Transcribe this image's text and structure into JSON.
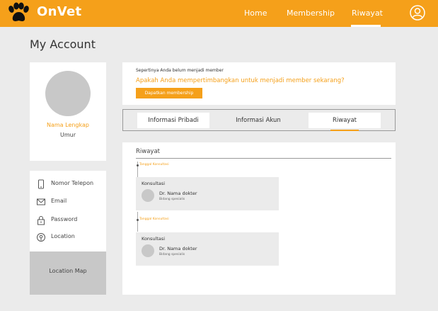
{
  "app": {
    "name": "OnVet"
  },
  "nav": {
    "items": [
      {
        "label": "Home"
      },
      {
        "label": "Membership"
      },
      {
        "label": "Riwayat"
      }
    ],
    "active": "Riwayat"
  },
  "page": {
    "title": "My Account"
  },
  "profile": {
    "name": "Nama Lengkap",
    "age": "Umur"
  },
  "contact": {
    "items": [
      {
        "label": "Nomor Telepon",
        "icon": "phone-icon"
      },
      {
        "label": "Email",
        "icon": "mail-icon"
      },
      {
        "label": "Password",
        "icon": "lock-icon"
      },
      {
        "label": "Location",
        "icon": "location-pin-icon"
      }
    ],
    "map_label": "Location Map"
  },
  "membership_banner": {
    "note": "Sepertinya Anda belum menjadi member",
    "question": "Apakah Anda mempertimbangkan untuk menjadi member sekarang?",
    "button_label": "Dapatkan membership"
  },
  "tabs": {
    "items": [
      {
        "label": "Informasi Pribadi"
      },
      {
        "label": "Informasi Akun"
      },
      {
        "label": "Riwayat"
      }
    ],
    "active": "Riwayat"
  },
  "history": {
    "title": "Riwayat",
    "entries": [
      {
        "date": "Tanggal Konsultasi",
        "type": "Konsultasi",
        "doctor": "Dr. Nama dokter",
        "specialty": "Bidang spesialis"
      },
      {
        "date": "Tanggal Konsultasi",
        "type": "Konsultasi",
        "doctor": "Dr. Nama dokter",
        "specialty": "Bidang spesialis"
      }
    ]
  },
  "colors": {
    "accent": "#f5a01a",
    "background": "#ebebeb",
    "card": "#ffffff",
    "placeholder": "#c8c8c8"
  }
}
